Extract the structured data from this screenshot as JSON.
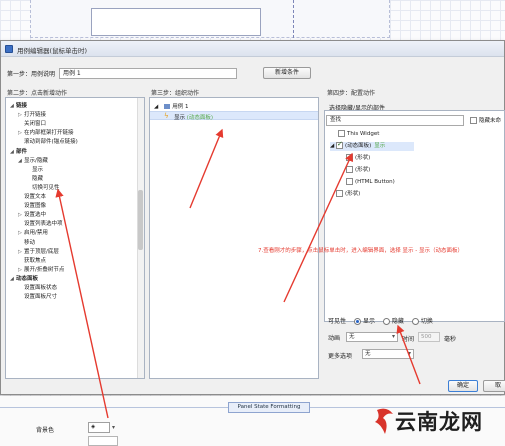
{
  "dialog": {
    "title": "用例编辑器(鼠标单击时)",
    "step1_label": "第一步：用例说明",
    "case_name_value": "用例 1",
    "new_condition_button": "新增条件",
    "step2_label": "第二步：点击新增动作",
    "step3_label": "第三步：组织动作",
    "step4_label": "第四步：配置动作",
    "ok_button": "确定",
    "cancel_button": "取"
  },
  "left_tree": [
    {
      "label": "链接",
      "arrow": "◢"
    },
    {
      "label": "打开链接",
      "arrow": "▷"
    },
    {
      "label": "关闭窗口",
      "arrow": ""
    },
    {
      "label": "在内部框架打开链接",
      "arrow": "▷"
    },
    {
      "label": "滚动到部件(锚点链接)",
      "arrow": ""
    },
    {
      "label": "部件",
      "arrow": "◢"
    },
    {
      "label": "显示/隐藏",
      "arrow": "◢"
    },
    {
      "label": "显示",
      "arrow": ""
    },
    {
      "label": "隐藏",
      "arrow": ""
    },
    {
      "label": "切换可见性",
      "arrow": ""
    },
    {
      "label": "设置文本",
      "arrow": ""
    },
    {
      "label": "设置图像",
      "arrow": ""
    },
    {
      "label": "设置选中",
      "arrow": "▷"
    },
    {
      "label": "设置列表选中项",
      "arrow": ""
    },
    {
      "label": "启用/禁用",
      "arrow": "▷"
    },
    {
      "label": "移动",
      "arrow": ""
    },
    {
      "label": "置于顶层/底层",
      "arrow": "▷"
    },
    {
      "label": "获取焦点",
      "arrow": ""
    },
    {
      "label": "展开/折叠树节点",
      "arrow": "▷"
    },
    {
      "label": "动态面板",
      "arrow": "◢"
    },
    {
      "label": "设置面板状态",
      "arrow": ""
    },
    {
      "label": "设置面板尺寸",
      "arrow": ""
    }
  ],
  "middle": {
    "case_node": "用例 1",
    "action_prefix": "显示",
    "action_target": "(动态面板)"
  },
  "right": {
    "section_label": "选择隐藏/显示的部件",
    "search_placeholder": "查找",
    "hide_unnamed_label": "隐藏未命",
    "items": [
      {
        "label": "This Widget",
        "checked": false
      },
      {
        "label": "(动态面板)",
        "suffix": "显示",
        "checked": true
      },
      {
        "label": "(形状)",
        "checked": false
      },
      {
        "label": "(形状)",
        "checked": false
      },
      {
        "label": "(HTML Button)",
        "checked": false
      },
      {
        "label": "(形状)",
        "checked": false
      }
    ]
  },
  "annotation": "7.查看刚才的步骤，点击鼠标单击时，进入编辑界面，选择 显示 - 显示（动态面板）",
  "config": {
    "visibility_label": "可见性",
    "visibility_options": [
      "显示",
      "隐藏",
      "切换"
    ],
    "visibility_selected": "显示",
    "animation_label": "动画",
    "animation_value": "无",
    "time_label": "时间",
    "time_value": "500",
    "ms_label": "毫秒",
    "more_options_label": "更多选项",
    "more_options_value": "无"
  },
  "bottom": {
    "panel_state_tab": "Panel State Formatting",
    "background_label": "背景色",
    "background_value": "◈"
  },
  "watermark": {
    "text": "云南龙网"
  },
  "colors": {
    "accent_red": "#e53a2f",
    "selection_blue": "#dce8fb",
    "dynamic_green": "#55a848"
  }
}
